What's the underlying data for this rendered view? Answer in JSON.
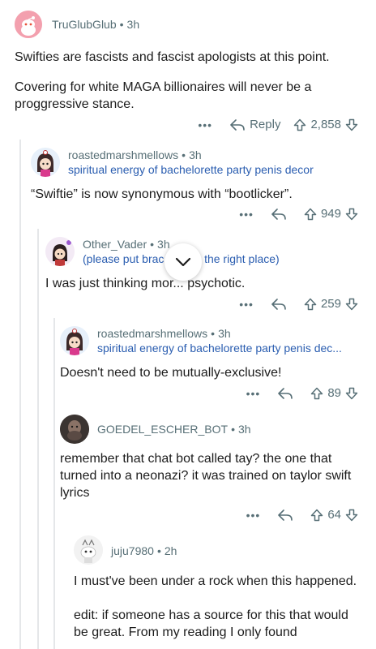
{
  "comments": [
    {
      "username": "TruGlubGlub",
      "time": "3h",
      "flair": "",
      "body": [
        "Swifties are fascists and fascist apologists at this point.",
        "Covering for white MAGA billionaires will never be a proggressive stance."
      ],
      "more": "•••",
      "reply_label": "Reply",
      "votes": "2,858"
    },
    {
      "username": "roastedmarshmellows",
      "time": "3h",
      "flair": "spiritual energy of bachelorette party penis decor",
      "body": [
        "“Swiftie” is now synonymous with “bootlicker”."
      ],
      "more": "•••",
      "votes": "949"
    },
    {
      "username": "Other_Vader",
      "time": "3h",
      "flair": "(please put brac",
      "flair_tail": "n the right place)",
      "body_a": "I was just thinking mor",
      "body_b": "... psychotic.",
      "more": "•••",
      "votes": "259"
    },
    {
      "username": "roastedmarshmellows",
      "time": "3h",
      "flair": "spiritual energy of bachelorette party penis dec...",
      "body": [
        "Doesn't need to be mutually-exclusive!"
      ],
      "more": "•••",
      "votes": "89"
    },
    {
      "username": "GOEDEL_ESCHER_BOT",
      "time": "3h",
      "flair": "",
      "body": [
        "remember that chat bot called tay? the one that turned into a neonazi? it was trained on taylor swift lyrics"
      ],
      "more": "•••",
      "votes": "64"
    },
    {
      "username": "juju7980",
      "time": "2h",
      "flair": "",
      "body": [
        "I must've been under a rock when this happened.",
        "edit: if someone has a source for this that would be great. From my reading I only found"
      ]
    }
  ],
  "dot": "•",
  "colors": {
    "meta": "#576f76",
    "flair": "#2a5db0",
    "text": "#1c1c1c"
  }
}
